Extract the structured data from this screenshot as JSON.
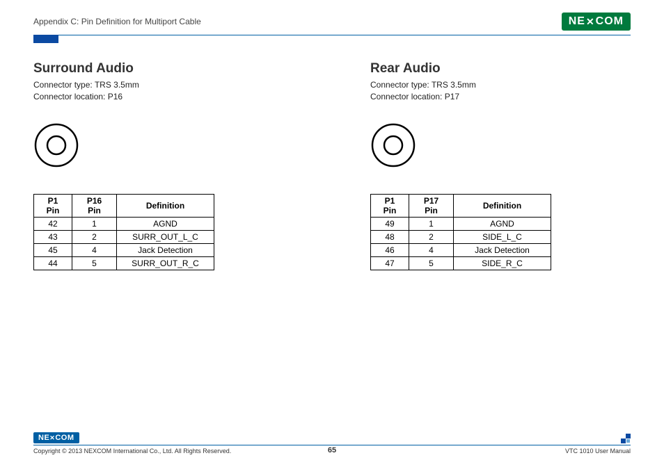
{
  "header": {
    "appendix": "Appendix C: Pin Definition for Multiport Cable",
    "logo_text": "NE COM"
  },
  "left": {
    "title": "Surround Audio",
    "type_label": "Connector type: TRS 3.5mm",
    "location_label": "Connector location: P16",
    "headers": {
      "p1": "P1 Pin",
      "pn": "P16 Pin",
      "def": "Definition"
    },
    "rows": [
      {
        "p1": "42",
        "pn": "1",
        "def": "AGND"
      },
      {
        "p1": "43",
        "pn": "2",
        "def": "SURR_OUT_L_C"
      },
      {
        "p1": "45",
        "pn": "4",
        "def": "Jack Detection"
      },
      {
        "p1": "44",
        "pn": "5",
        "def": "SURR_OUT_R_C"
      }
    ]
  },
  "right": {
    "title": "Rear Audio",
    "type_label": "Connector type: TRS 3.5mm",
    "location_label": "Connector location: P17",
    "headers": {
      "p1": "P1 Pin",
      "pn": "P17 Pin",
      "def": "Definition"
    },
    "rows": [
      {
        "p1": "49",
        "pn": "1",
        "def": "AGND"
      },
      {
        "p1": "48",
        "pn": "2",
        "def": "SIDE_L_C"
      },
      {
        "p1": "46",
        "pn": "4",
        "def": "Jack Detection"
      },
      {
        "p1": "47",
        "pn": "5",
        "def": "SIDE_R_C"
      }
    ]
  },
  "footer": {
    "logo_text": "NE COM",
    "copyright": "Copyright © 2013 NEXCOM International Co., Ltd. All Rights Reserved.",
    "page": "65",
    "manual": "VTC 1010 User Manual"
  }
}
